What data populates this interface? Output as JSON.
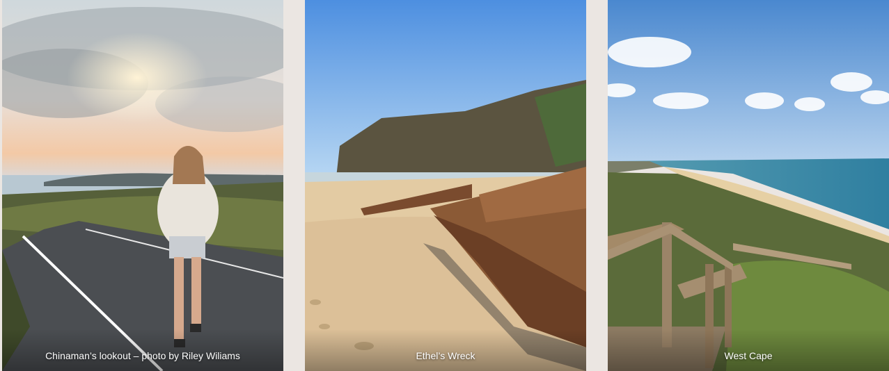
{
  "gallery": {
    "items": [
      {
        "caption": "Chinaman’s lookout – photo by Riley Wiliams",
        "scene": "person walking on coastal road at sunset"
      },
      {
        "caption": "Ethel’s Wreck",
        "scene": "rusted shipwreck on beach below cliffs"
      },
      {
        "caption": "West Cape",
        "scene": "wooden boardwalk over coastal heath and beach"
      }
    ]
  }
}
